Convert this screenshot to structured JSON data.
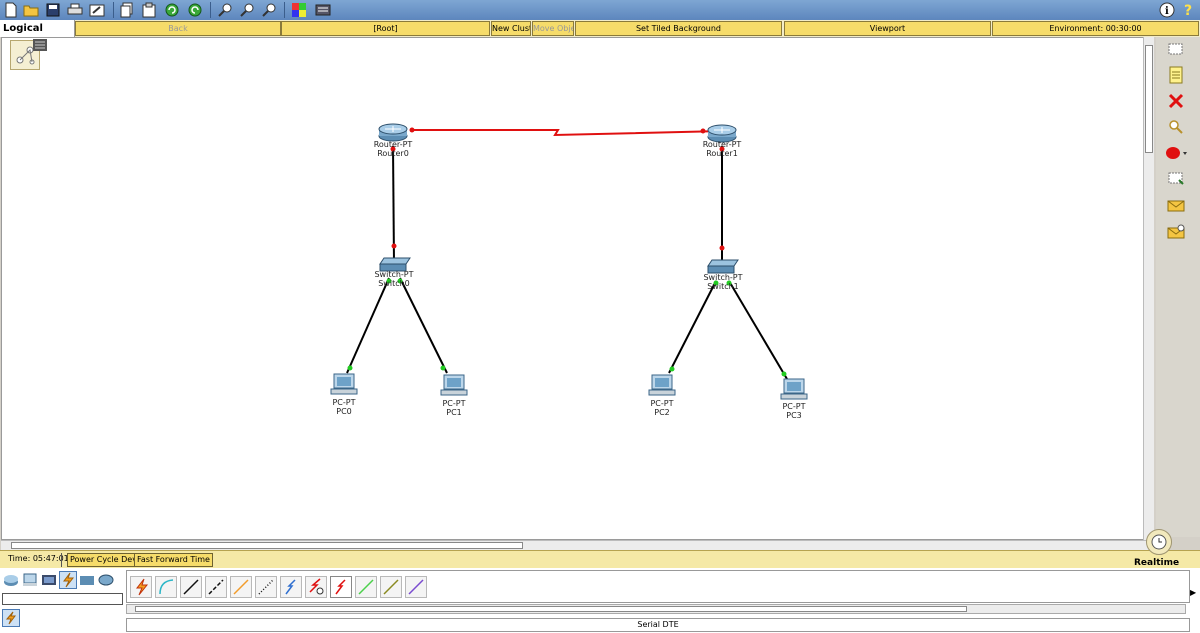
{
  "toolbar": {
    "icons": [
      "new-file",
      "open-folder",
      "save",
      "print",
      "activity-wizard",
      "copy",
      "paste",
      "undo",
      "redo",
      "zoom-in",
      "zoom-reset",
      "zoom-out",
      "palette",
      "custom-device",
      "info",
      "help"
    ]
  },
  "secbar": {
    "tab_label": "Logical",
    "back_label": "Back",
    "root_label": "[Root]",
    "new_cluster_label": "New Cluster",
    "move_object_label": "Move Object",
    "tiled_bg_label": "Set Tiled Background",
    "viewport_label": "Viewport",
    "environment_label": "Environment: 00:30:00"
  },
  "devices": [
    {
      "name": "router0",
      "type_label": "Router-PT",
      "name_label": "Router0"
    },
    {
      "name": "router1",
      "type_label": "Router-PT",
      "name_label": "Router1"
    },
    {
      "name": "switch0",
      "type_label": "Switch-PT",
      "name_label": "Switch0"
    },
    {
      "name": "switch1",
      "type_label": "Switch-PT",
      "name_label": "Switch1"
    },
    {
      "name": "pc0",
      "type_label": "PC-PT",
      "name_label": "PC0"
    },
    {
      "name": "pc1",
      "type_label": "PC-PT",
      "name_label": "PC1"
    },
    {
      "name": "pc2",
      "type_label": "PC-PT",
      "name_label": "PC2"
    },
    {
      "name": "pc3",
      "type_label": "PC-PT",
      "name_label": "PC3"
    }
  ],
  "link_colors": {
    "serial": "#e01010",
    "copper": "#000000",
    "port_down": "#e01010",
    "port_up": "#22cc22"
  },
  "status": {
    "time_label": "Time: 05:47:01",
    "power_cycle_label": "Power Cycle Devices",
    "fast_forward_label": "Fast Forward Time",
    "mode_label": "Realtime"
  },
  "cables": [
    "automatic",
    "console",
    "copper-straight",
    "copper-cross",
    "fiber",
    "phone",
    "coaxial",
    "serial-dce",
    "serial-dte",
    "octal",
    "iot-custom",
    "usb"
  ],
  "selected_cable_label": "Serial DTE"
}
